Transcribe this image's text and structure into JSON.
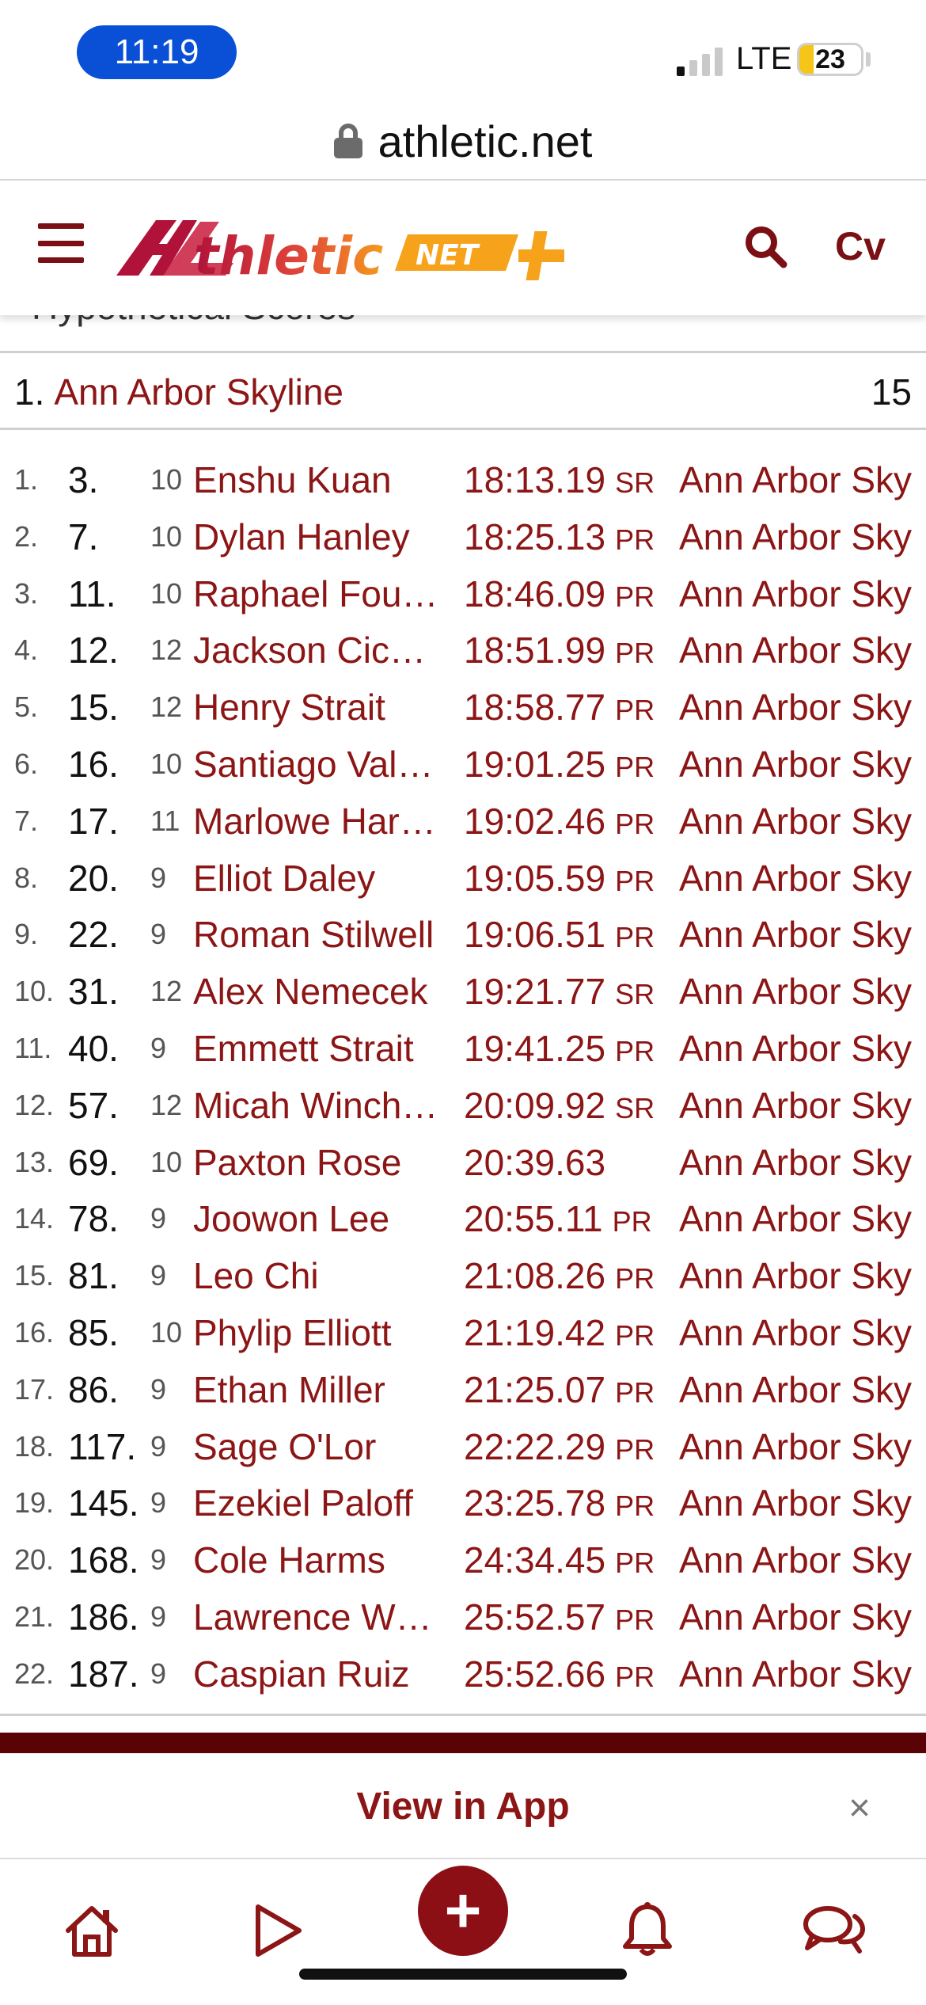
{
  "status_bar": {
    "time": "11:19",
    "network": "LTE",
    "battery": "23"
  },
  "browser": {
    "url": "athletic.net"
  },
  "header": {
    "user_initials": "Cv"
  },
  "section_title": "Hypothetical Scores",
  "team_result": {
    "rank": "1.",
    "name": "Ann Arbor Skyline",
    "score": "15"
  },
  "results": [
    {
      "idx": "1.",
      "place": "3.",
      "grade": "10",
      "name": "Enshu Kuan",
      "time": "18:13.19",
      "mark": "SR",
      "team": "Ann Arbor Sky"
    },
    {
      "idx": "2.",
      "place": "7.",
      "grade": "10",
      "name": "Dylan Hanley",
      "time": "18:25.13",
      "mark": "PR",
      "team": "Ann Arbor Sky"
    },
    {
      "idx": "3.",
      "place": "11.",
      "grade": "10",
      "name": "Raphael Fou…",
      "time": "18:46.09",
      "mark": "PR",
      "team": "Ann Arbor Sky"
    },
    {
      "idx": "4.",
      "place": "12.",
      "grade": "12",
      "name": "Jackson Cic…",
      "time": "18:51.99",
      "mark": "PR",
      "team": "Ann Arbor Sky"
    },
    {
      "idx": "5.",
      "place": "15.",
      "grade": "12",
      "name": "Henry Strait",
      "time": "18:58.77",
      "mark": "PR",
      "team": "Ann Arbor Sky"
    },
    {
      "idx": "6.",
      "place": "16.",
      "grade": "10",
      "name": "Santiago Val…",
      "time": "19:01.25",
      "mark": "PR",
      "team": "Ann Arbor Sky"
    },
    {
      "idx": "7.",
      "place": "17.",
      "grade": "11",
      "name": "Marlowe Har…",
      "time": "19:02.46",
      "mark": "PR",
      "team": "Ann Arbor Sky"
    },
    {
      "idx": "8.",
      "place": "20.",
      "grade": "9",
      "name": "Elliot Daley",
      "time": "19:05.59",
      "mark": "PR",
      "team": "Ann Arbor Sky"
    },
    {
      "idx": "9.",
      "place": "22.",
      "grade": "9",
      "name": "Roman Stilwell",
      "time": "19:06.51",
      "mark": "PR",
      "team": "Ann Arbor Sky"
    },
    {
      "idx": "10.",
      "place": "31.",
      "grade": "12",
      "name": "Alex Nemecek",
      "time": "19:21.77",
      "mark": "SR",
      "team": "Ann Arbor Sky"
    },
    {
      "idx": "11.",
      "place": "40.",
      "grade": "9",
      "name": "Emmett Strait",
      "time": "19:41.25",
      "mark": "PR",
      "team": "Ann Arbor Sky"
    },
    {
      "idx": "12.",
      "place": "57.",
      "grade": "12",
      "name": "Micah Winch…",
      "time": "20:09.92",
      "mark": "SR",
      "team": "Ann Arbor Sky"
    },
    {
      "idx": "13.",
      "place": "69.",
      "grade": "10",
      "name": "Paxton Rose",
      "time": "20:39.63",
      "mark": "",
      "team": "Ann Arbor Sky"
    },
    {
      "idx": "14.",
      "place": "78.",
      "grade": "9",
      "name": "Joowon Lee",
      "time": "20:55.11",
      "mark": "PR",
      "team": "Ann Arbor Sky"
    },
    {
      "idx": "15.",
      "place": "81.",
      "grade": "9",
      "name": "Leo Chi",
      "time": "21:08.26",
      "mark": "PR",
      "team": "Ann Arbor Sky"
    },
    {
      "idx": "16.",
      "place": "85.",
      "grade": "10",
      "name": "Phylip Elliott",
      "time": "21:19.42",
      "mark": "PR",
      "team": "Ann Arbor Sky"
    },
    {
      "idx": "17.",
      "place": "86.",
      "grade": "9",
      "name": "Ethan Miller",
      "time": "21:25.07",
      "mark": "PR",
      "team": "Ann Arbor Sky"
    },
    {
      "idx": "18.",
      "place": "117.",
      "grade": "9",
      "name": "Sage O'Lor",
      "time": "22:22.29",
      "mark": "PR",
      "team": "Ann Arbor Sky"
    },
    {
      "idx": "19.",
      "place": "145.",
      "grade": "9",
      "name": "Ezekiel Paloff",
      "time": "23:25.78",
      "mark": "PR",
      "team": "Ann Arbor Sky"
    },
    {
      "idx": "20.",
      "place": "168.",
      "grade": "9",
      "name": "Cole Harms",
      "time": "24:34.45",
      "mark": "PR",
      "team": "Ann Arbor Sky"
    },
    {
      "idx": "21.",
      "place": "186.",
      "grade": "9",
      "name": "Lawrence W…",
      "time": "25:52.57",
      "mark": "PR",
      "team": "Ann Arbor Sky"
    },
    {
      "idx": "22.",
      "place": "187.",
      "grade": "9",
      "name": "Caspian Ruiz",
      "time": "25:52.66",
      "mark": "PR",
      "team": "Ann Arbor Sky"
    }
  ],
  "app_banner": {
    "label": "View in App",
    "close": "×"
  },
  "bottom_nav": {
    "plus": "+"
  },
  "icons": {
    "menu": "hamburger-menu-icon",
    "search": "search-icon",
    "lock": "lock-icon",
    "home": "home-icon",
    "play": "play-icon",
    "bell": "bell-icon",
    "chat": "chat-icon"
  },
  "colors": {
    "brand": "#8c1515",
    "brand_dark": "#5a0306",
    "accent_orange": "#f7a21b",
    "time_pill": "#0a50d6"
  }
}
